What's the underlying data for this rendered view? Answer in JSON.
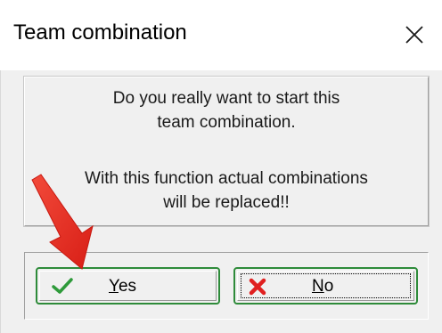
{
  "dialog": {
    "title": "Team combination",
    "close_icon": "close-x-icon",
    "message": {
      "line1": "Do you really want to start this",
      "line2": "team combination.",
      "line3": "With this function actual combinations",
      "line4": "will be replaced!!"
    },
    "buttons": {
      "yes": {
        "label_accel": "Y",
        "label_rest": "es",
        "icon": "green-check-icon",
        "accent": "#2e8b3a"
      },
      "no": {
        "label_accel": "N",
        "label_rest": "o",
        "icon": "red-x-icon",
        "accent": "#e02020"
      }
    }
  },
  "annotation": {
    "arrow_icon": "red-arrow-icon",
    "arrow_color": "#e8251f"
  }
}
